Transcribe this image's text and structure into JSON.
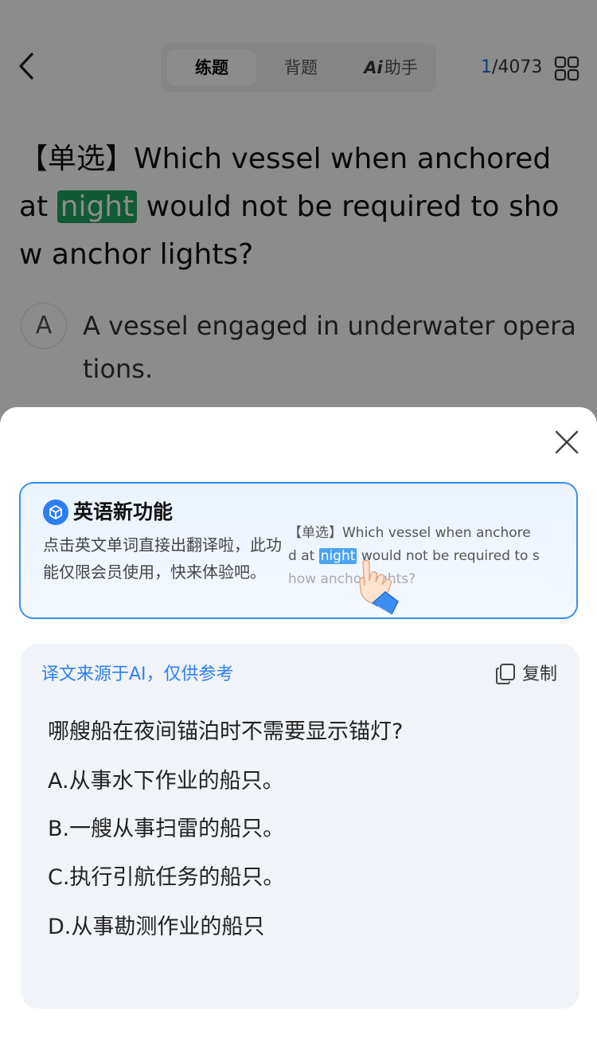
{
  "header": {
    "tabs": [
      {
        "label": "练题"
      },
      {
        "label": "背题"
      },
      {
        "label": "助手"
      }
    ],
    "counter_current": "1",
    "counter_total": "/4073"
  },
  "question": {
    "prefix": "【单选】Which vessel when anchored at ",
    "highlight": "night",
    "suffix": " would not be required to show anchor lights?"
  },
  "option_a": {
    "letter": "A",
    "text": "A vessel engaged in underwater operations."
  },
  "promo": {
    "title": "英语新功能",
    "description": "点击英文单词直接出翻译啦，此功能仅限会员使用，快来体验吧。",
    "demo_line1": "【单选】Which vessel when anchore",
    "demo_line2_pre": "d at ",
    "demo_line2_hl": "night",
    "demo_line2_post": " would not be required to s",
    "demo_line3": "how anchor lights?"
  },
  "translation": {
    "source_note": "译文来源于AI，仅供参考",
    "copy_label": "复制",
    "lines": [
      "哪艘船在夜间锚泊时不需要显示锚灯?",
      "A.从事水下作业的船只。",
      "B.一艘从事扫雷的船只。",
      "C.执行引航任务的船只。",
      "D.从事勘测作业的船只"
    ]
  },
  "colors": {
    "accent_blue": "#2f80ed",
    "highlight_green": "#1fa463",
    "overlay": "rgba(0,0,0,0.45)"
  }
}
